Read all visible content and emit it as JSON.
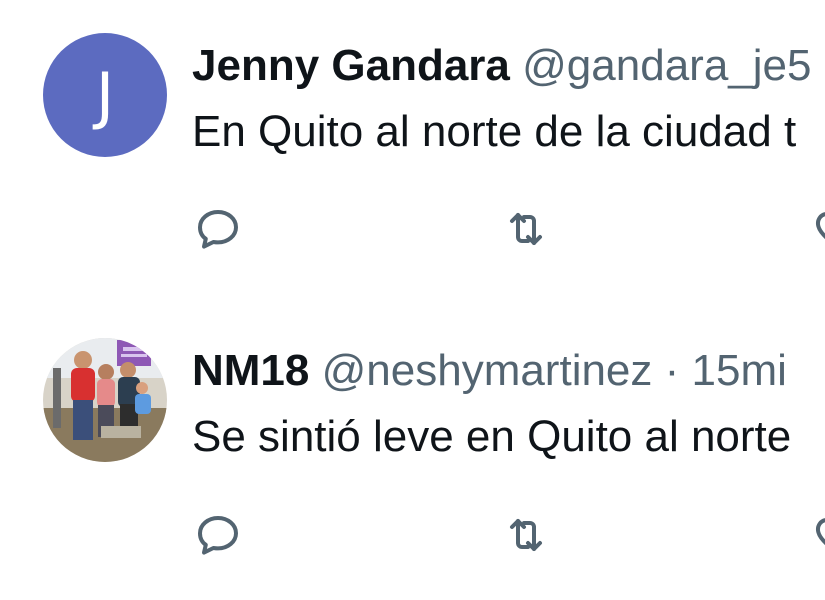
{
  "tweets": [
    {
      "author_name": "Jenny Gandara",
      "author_handle": "@gandara_je5",
      "avatar_letter": "J",
      "avatar_color": "#5c6bc0",
      "text": "En Quito al norte de la ciudad t",
      "icons": [
        "reply-icon",
        "retweet-icon",
        "like-icon"
      ]
    },
    {
      "author_name": "NM18",
      "author_handle": "@neshymartinez",
      "separator": "·",
      "time": "15mi",
      "avatar_type": "family-photo",
      "text": "Se sintió leve en Quito al norte",
      "icons": [
        "reply-icon",
        "retweet-icon",
        "like-icon"
      ]
    }
  ],
  "colors": {
    "name": "#0f1419",
    "secondary": "#536471",
    "divider": "#eff3f4"
  }
}
